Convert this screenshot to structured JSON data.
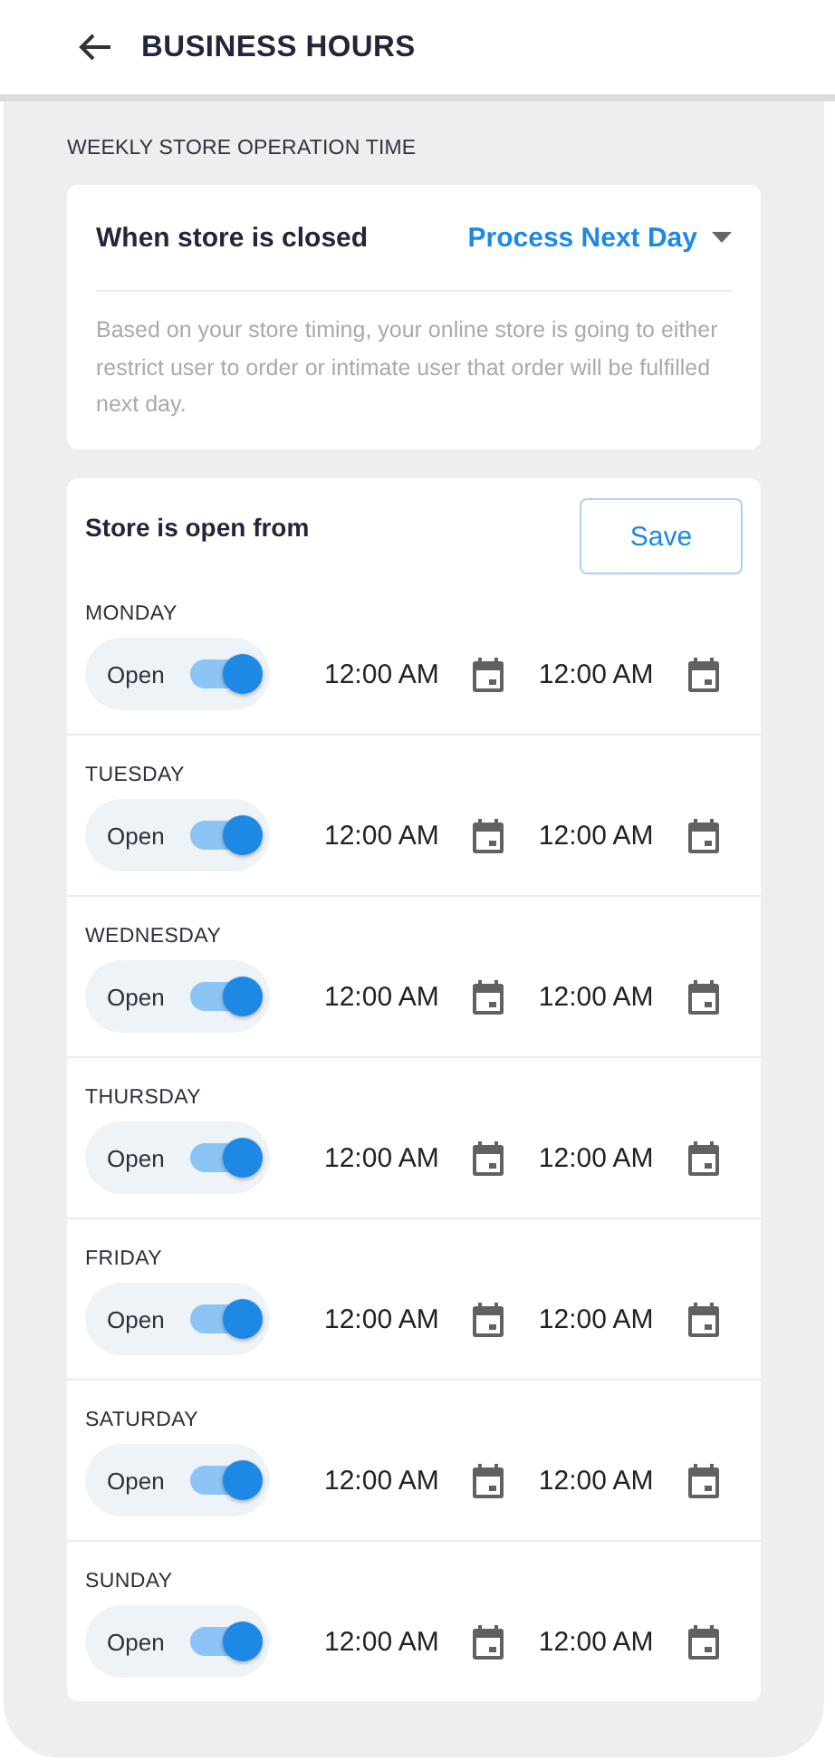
{
  "header": {
    "title": "BUSINESS HOURS"
  },
  "section_label": "WEEKLY STORE OPERATION TIME",
  "closed_card": {
    "label": "When store is closed",
    "value": "Process Next Day",
    "description": "Based on your store timing, your online store is going to either restrict user to order or intimate user that order will be fulfilled next day."
  },
  "hours_card": {
    "title": "Store is open from",
    "save_button": "Save",
    "days": [
      {
        "name": "MONDAY",
        "status_label": "Open",
        "open": true,
        "from": "12:00 AM",
        "to": "12:00 AM"
      },
      {
        "name": "TUESDAY",
        "status_label": "Open",
        "open": true,
        "from": "12:00 AM",
        "to": "12:00 AM"
      },
      {
        "name": "WEDNESDAY",
        "status_label": "Open",
        "open": true,
        "from": "12:00 AM",
        "to": "12:00 AM"
      },
      {
        "name": "THURSDAY",
        "status_label": "Open",
        "open": true,
        "from": "12:00 AM",
        "to": "12:00 AM"
      },
      {
        "name": "FRIDAY",
        "status_label": "Open",
        "open": true,
        "from": "12:00 AM",
        "to": "12:00 AM"
      },
      {
        "name": "SATURDAY",
        "status_label": "Open",
        "open": true,
        "from": "12:00 AM",
        "to": "12:00 AM"
      },
      {
        "name": "SUNDAY",
        "status_label": "Open",
        "open": true,
        "from": "12:00 AM",
        "to": "12:00 AM"
      }
    ]
  }
}
